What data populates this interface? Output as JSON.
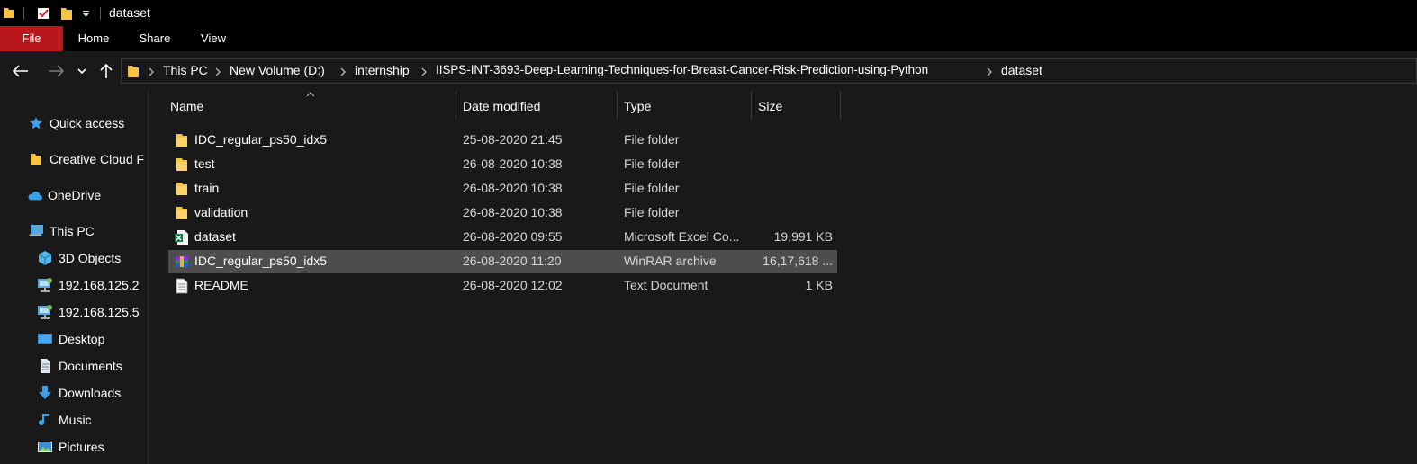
{
  "window": {
    "title": "dataset"
  },
  "ribbon": {
    "tabs": [
      "File",
      "Home",
      "Share",
      "View"
    ]
  },
  "address": {
    "crumbs": [
      "This PC",
      "New Volume (D:)",
      "internship",
      "IISPS-INT-3693-Deep-Learning-Techniques-for-Breast-Cancer-Risk-Prediction-using-Python",
      "dataset"
    ]
  },
  "sidebar": {
    "items": [
      {
        "label": "Quick access",
        "icon": "star-icon"
      },
      {
        "label": "Creative Cloud F",
        "icon": "folder-icon"
      },
      {
        "label": "OneDrive",
        "icon": "cloud-icon"
      },
      {
        "label": "This PC",
        "icon": "computer-icon"
      },
      {
        "label": "3D Objects",
        "icon": "cube-icon"
      },
      {
        "label": "192.168.125.2",
        "icon": "network-drive-icon"
      },
      {
        "label": "192.168.125.5",
        "icon": "network-drive-icon"
      },
      {
        "label": "Desktop",
        "icon": "desktop-icon"
      },
      {
        "label": "Documents",
        "icon": "documents-icon"
      },
      {
        "label": "Downloads",
        "icon": "download-icon"
      },
      {
        "label": "Music",
        "icon": "music-icon"
      },
      {
        "label": "Pictures",
        "icon": "pictures-icon"
      }
    ]
  },
  "columns": {
    "name": "Name",
    "date": "Date modified",
    "type": "Type",
    "size": "Size"
  },
  "files": [
    {
      "name": "IDC_regular_ps50_idx5",
      "date": "25-08-2020 21:45",
      "type": "File folder",
      "size": "",
      "icon": "folder-icon"
    },
    {
      "name": "test",
      "date": "26-08-2020 10:38",
      "type": "File folder",
      "size": "",
      "icon": "folder-icon"
    },
    {
      "name": "train",
      "date": "26-08-2020 10:38",
      "type": "File folder",
      "size": "",
      "icon": "folder-icon"
    },
    {
      "name": "validation",
      "date": "26-08-2020 10:38",
      "type": "File folder",
      "size": "",
      "icon": "folder-icon"
    },
    {
      "name": "dataset",
      "date": "26-08-2020 09:55",
      "type": "Microsoft Excel Co...",
      "size": "19,991 KB",
      "icon": "excel-icon"
    },
    {
      "name": "IDC_regular_ps50_idx5",
      "date": "26-08-2020 11:20",
      "type": "WinRAR archive",
      "size": "16,17,618 ...",
      "icon": "winrar-icon"
    },
    {
      "name": "README",
      "date": "26-08-2020 12:02",
      "type": "Text Document",
      "size": "1 KB",
      "icon": "text-document-icon"
    }
  ],
  "colors": {
    "file_tab": "#b8171d",
    "folder": "#f5c542",
    "selected_row": "#4d4d4d"
  }
}
